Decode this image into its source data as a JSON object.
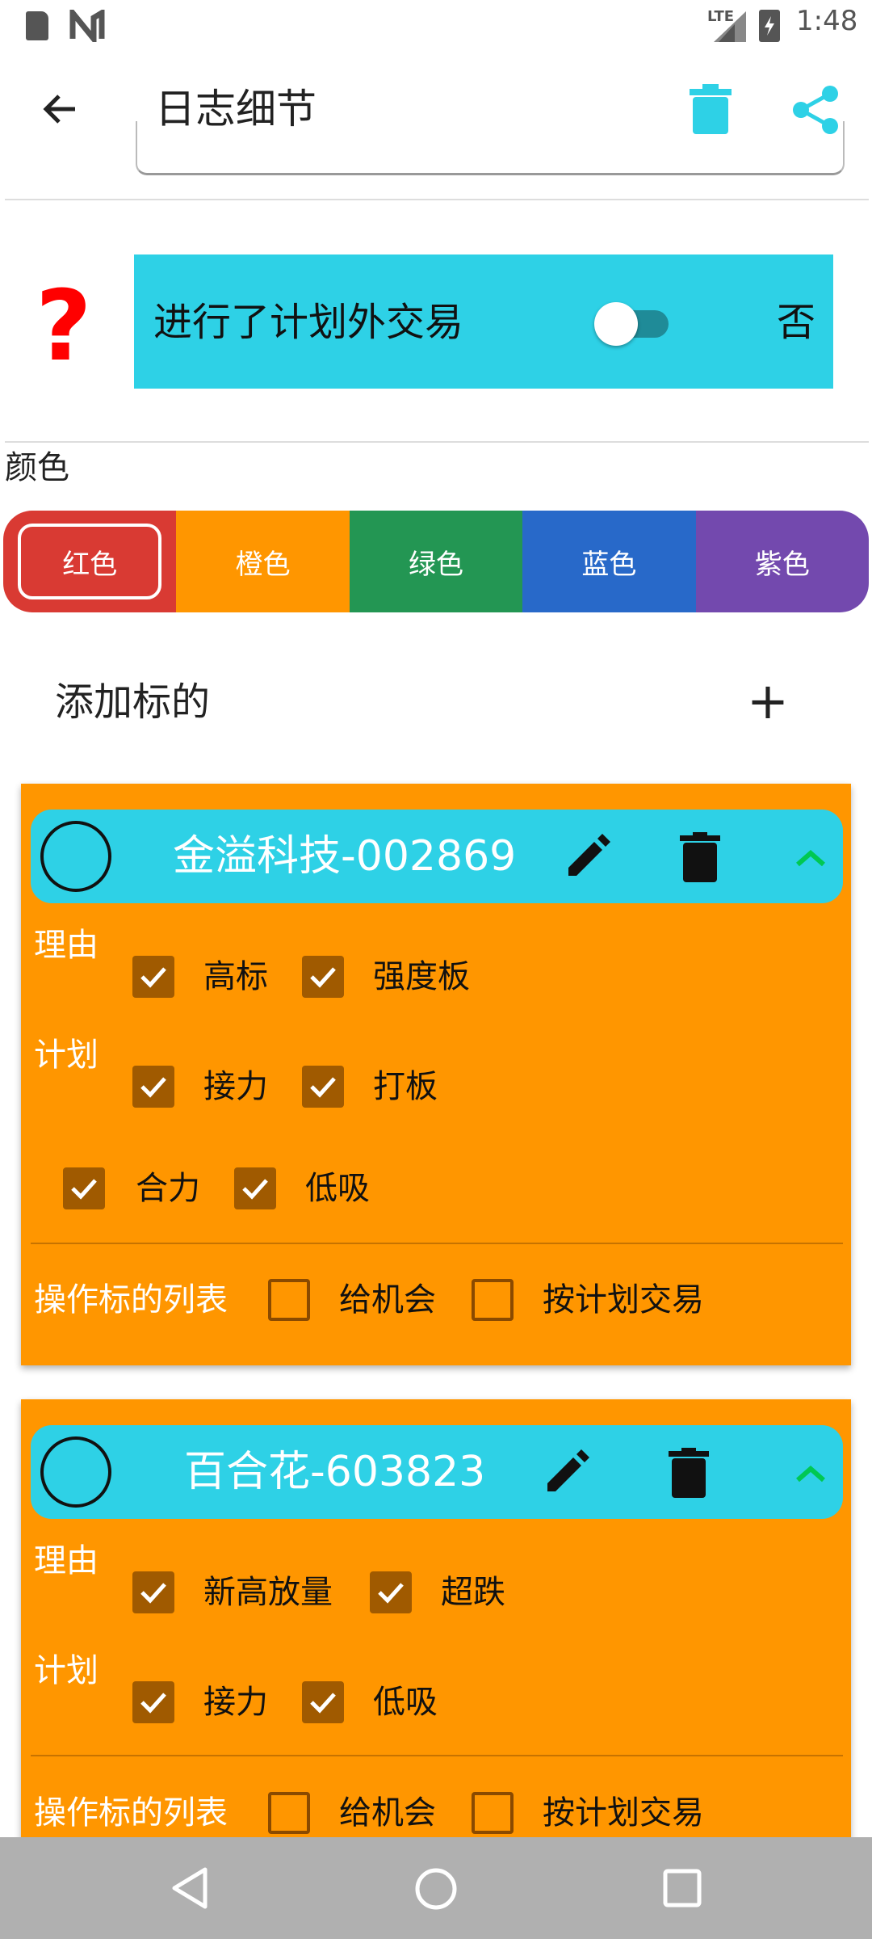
{
  "status_bar": {
    "time": "1:48",
    "network": "LTE"
  },
  "app_bar": {
    "title": "日志细节"
  },
  "unplanned_trade": {
    "label": "进行了计划外交易",
    "value": "否",
    "on": false
  },
  "color_section": {
    "title": "颜色",
    "options": [
      {
        "label": "红色",
        "color": "#d93a33",
        "selected": true
      },
      {
        "label": "橙色",
        "color": "#ff9600",
        "selected": false
      },
      {
        "label": "绿色",
        "color": "#239653",
        "selected": false
      },
      {
        "label": "蓝色",
        "color": "#2869c9",
        "selected": false
      },
      {
        "label": "紫色",
        "color": "#7349ae",
        "selected": false
      }
    ]
  },
  "add_target": {
    "label": "添加标的",
    "button": "+"
  },
  "cards": [
    {
      "name": "金溢科技-002869",
      "reason_label": "理由",
      "plan_label": "计划",
      "reasons": [
        "高标",
        "强度板"
      ],
      "plans": [
        "接力",
        "打板",
        "合力",
        "低吸"
      ],
      "ops_label": "操作标的列表",
      "ops": [
        "给机会",
        "按计划交易"
      ]
    },
    {
      "name": "百合花-603823",
      "reason_label": "理由",
      "plan_label": "计划",
      "reasons": [
        "新高放量",
        "超跌"
      ],
      "plans": [
        "接力",
        "低吸"
      ],
      "ops_label": "操作标的列表",
      "ops": [
        "给机会",
        "按计划交易"
      ]
    }
  ],
  "colors": {
    "accent": "#2ed1e6",
    "card": "#ff9600",
    "alert": "#ff0000",
    "up_arrow": "#00c853"
  }
}
